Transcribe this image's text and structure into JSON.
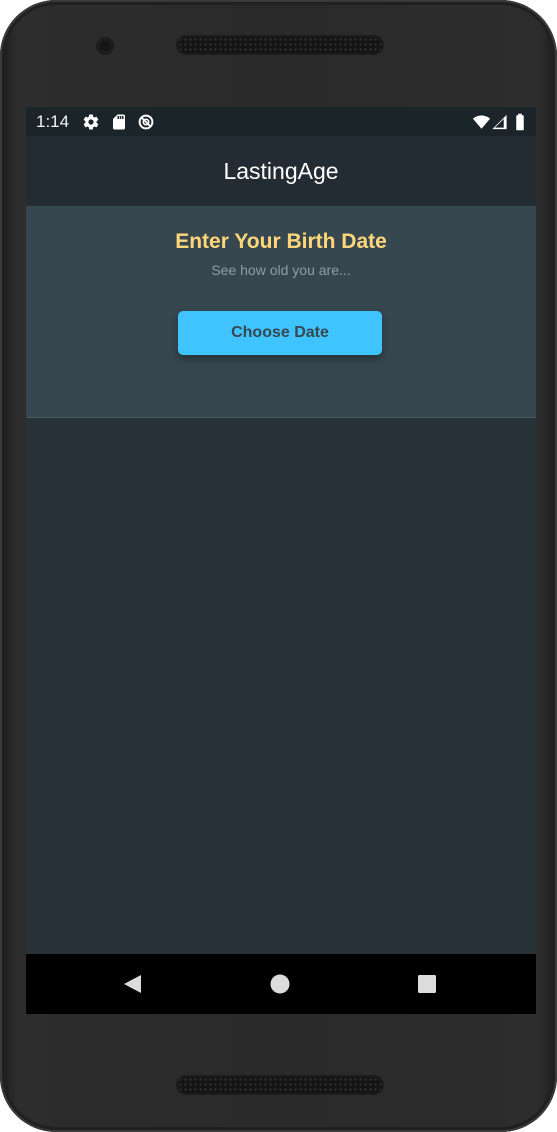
{
  "status_bar": {
    "time": "1:14",
    "left_icons": [
      "gear-icon",
      "sd-card-icon",
      "no-sync-icon"
    ],
    "right_icons": [
      "wifi-icon",
      "signal-icon",
      "battery-icon"
    ]
  },
  "app_bar": {
    "title": "LastingAge"
  },
  "card": {
    "title": "Enter Your Birth Date",
    "subtitle": "See how old you are...",
    "button_label": "Choose Date"
  },
  "nav_bar": {
    "buttons": [
      "back-icon",
      "home-icon",
      "recents-icon"
    ]
  },
  "colors": {
    "background": "#263238",
    "app_bar": "#232c32",
    "card": "#37474f",
    "accent_title": "#ffd77a",
    "button": "#40c4ff",
    "status_bar": "#1b2529",
    "nav_bar": "#000000"
  }
}
